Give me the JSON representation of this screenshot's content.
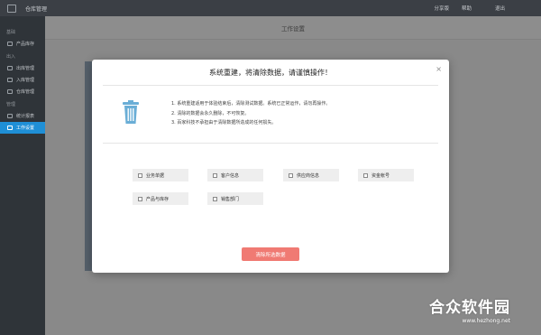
{
  "titlebar": {
    "app_title": "仓库管理",
    "menu": [
      "分享版",
      "帮助"
    ],
    "exit_label": "退出"
  },
  "sidebar": {
    "groups": [
      "基础",
      "出入",
      "管理"
    ],
    "items": [
      "产品库存",
      "出库管理",
      "入库管理",
      "仓库管理",
      "统计报表",
      "工作设置"
    ],
    "active_index": 5
  },
  "main": {
    "header": "工作设置"
  },
  "dialog": {
    "title": "系统重建，将清除数据，请谨慎操作！",
    "close_label": "×",
    "notes": [
      "1. 系统重建适用于体验结束后，清除测试数据。系统已正常运作，请勿再操作。",
      "2. 清除的数据会永久删除，不可恢复。",
      "3. 百家科技不承担由于清除数据所造成的任何损失。"
    ],
    "options": [
      "业务单据",
      "客户信息",
      "供应商信息",
      "资金帐号",
      "产品与库存",
      "销售部门"
    ],
    "clear_button": "清除所选数据"
  },
  "watermark": {
    "brand": "合众软件园",
    "url": "www.hezhong.net"
  },
  "colors": {
    "accent": "#1f8fd6",
    "danger_button": "#f07a73",
    "titlebar": "#3b3f45",
    "sidebar": "#2f3439",
    "trash": "#6aaed6"
  }
}
